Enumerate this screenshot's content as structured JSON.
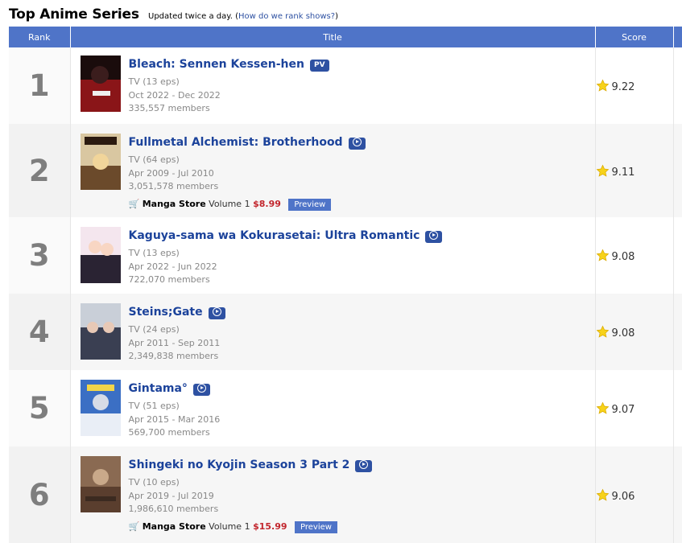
{
  "header": {
    "title": "Top Anime Series",
    "updated_text": "Updated twice a day.",
    "open_paren": "(",
    "how_rank_link": "How do we rank shows?",
    "close_paren": ")"
  },
  "columns": {
    "rank": "Rank",
    "title": "Title",
    "score": "Score"
  },
  "icons": {
    "cart": "shopping-cart-icon",
    "star": "star-icon",
    "play": "play-icon"
  },
  "colors": {
    "header_bg": "#4f74c8",
    "title_link": "#1c439b",
    "price": "#c2262d",
    "badge": "#2e51a2",
    "star": "#f7d21a"
  },
  "rows": [
    {
      "rank": "1",
      "title": "Bleach: Sennen Kessen-hen",
      "badge": "PV",
      "type": "TV (13 eps)",
      "dates": "Oct 2022 - Dec 2022",
      "members": "335,557 members",
      "score": "9.22"
    },
    {
      "rank": "2",
      "title": "Fullmetal Alchemist: Brotherhood",
      "badge": "play",
      "type": "TV (64 eps)",
      "dates": "Apr 2009 - Jul 2010",
      "members": "3,051,578 members",
      "score": "9.11",
      "store": {
        "name": "Manga Store",
        "volume": "Volume 1",
        "price": "$8.99",
        "preview": "Preview"
      }
    },
    {
      "rank": "3",
      "title": "Kaguya-sama wa Kokurasetai: Ultra Romantic",
      "badge": "play",
      "type": "TV (13 eps)",
      "dates": "Apr 2022 - Jun 2022",
      "members": "722,070 members",
      "score": "9.08"
    },
    {
      "rank": "4",
      "title": "Steins;Gate",
      "badge": "play",
      "type": "TV (24 eps)",
      "dates": "Apr 2011 - Sep 2011",
      "members": "2,349,838 members",
      "score": "9.08"
    },
    {
      "rank": "5",
      "title": "Gintama°",
      "badge": "play",
      "type": "TV (51 eps)",
      "dates": "Apr 2015 - Mar 2016",
      "members": "569,700 members",
      "score": "9.07"
    },
    {
      "rank": "6",
      "title": "Shingeki no Kyojin Season 3 Part 2",
      "badge": "play",
      "type": "TV (10 eps)",
      "dates": "Apr 2019 - Jul 2019",
      "members": "1,986,610 members",
      "score": "9.06",
      "store": {
        "name": "Manga Store",
        "volume": "Volume 1",
        "price": "$15.99",
        "preview": "Preview"
      }
    }
  ]
}
